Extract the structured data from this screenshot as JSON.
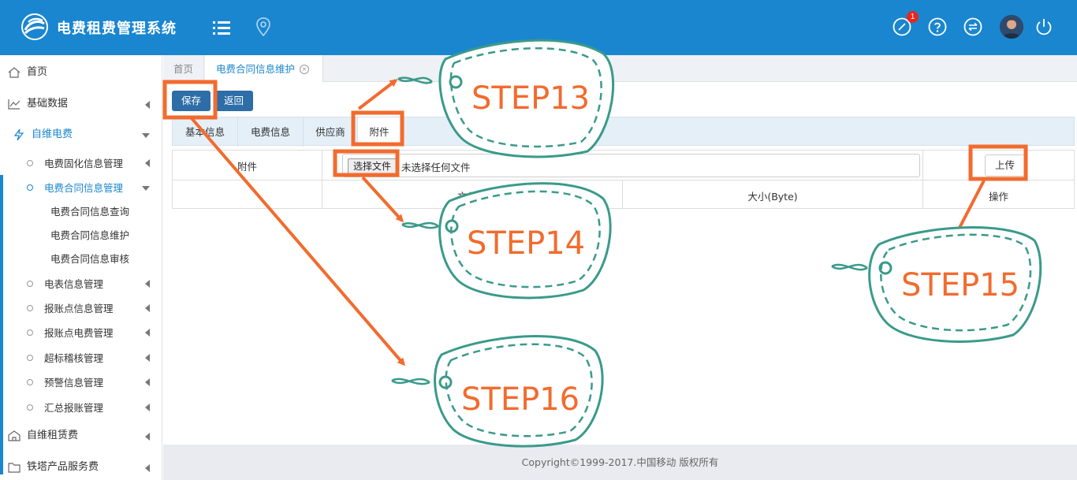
{
  "header": {
    "app_title": "电费租费管理系统",
    "notification_count": "1",
    "brand_color": "#1a86d0"
  },
  "sidebar": {
    "items": [
      {
        "label": "首页",
        "icon": "home-icon"
      },
      {
        "label": "基础数据",
        "icon": "chart-line-icon"
      },
      {
        "label": "自维电费",
        "icon": "lightning-icon"
      },
      {
        "label": "自维租赁费",
        "icon": "building-icon"
      },
      {
        "label": "铁塔产品服务费",
        "icon": "folder-icon"
      }
    ],
    "sub_items": [
      {
        "label": "电费固化信息管理"
      },
      {
        "label": "电费合同信息管理"
      },
      {
        "label": "电表信息管理"
      },
      {
        "label": "报账点信息管理"
      },
      {
        "label": "报账点电费管理"
      },
      {
        "label": "超标稽核管理"
      },
      {
        "label": "预警信息管理"
      },
      {
        "label": "汇总报账管理"
      }
    ],
    "leaf_items": [
      {
        "label": "电费合同信息查询"
      },
      {
        "label": "电费合同信息维护"
      },
      {
        "label": "电费合同信息审核"
      }
    ]
  },
  "tabs": {
    "home": "首页",
    "active": "电费合同信息维护",
    "close_glyph": "×"
  },
  "toolbar": {
    "save_label": "保存",
    "back_label": "返回"
  },
  "subtabs": [
    {
      "label": "基本信息"
    },
    {
      "label": "电费信息"
    },
    {
      "label": "供应商"
    },
    {
      "label": "附件"
    }
  ],
  "attachment": {
    "row_label": "附件",
    "choose_file_label": "选择文件",
    "no_file_text": "未选择任何文件",
    "upload_label": "上传",
    "col_name": "文件名",
    "col_size": "大小(Byte)",
    "col_action": "操作"
  },
  "footer": {
    "copyright": "Copyright©1999-2017.中国移动 版权所有"
  },
  "annotations": {
    "steps": [
      "STEP13",
      "STEP14",
      "STEP15",
      "STEP16"
    ],
    "tag_color": "#3a9a8a",
    "highlight_color": "#f26b2e"
  }
}
